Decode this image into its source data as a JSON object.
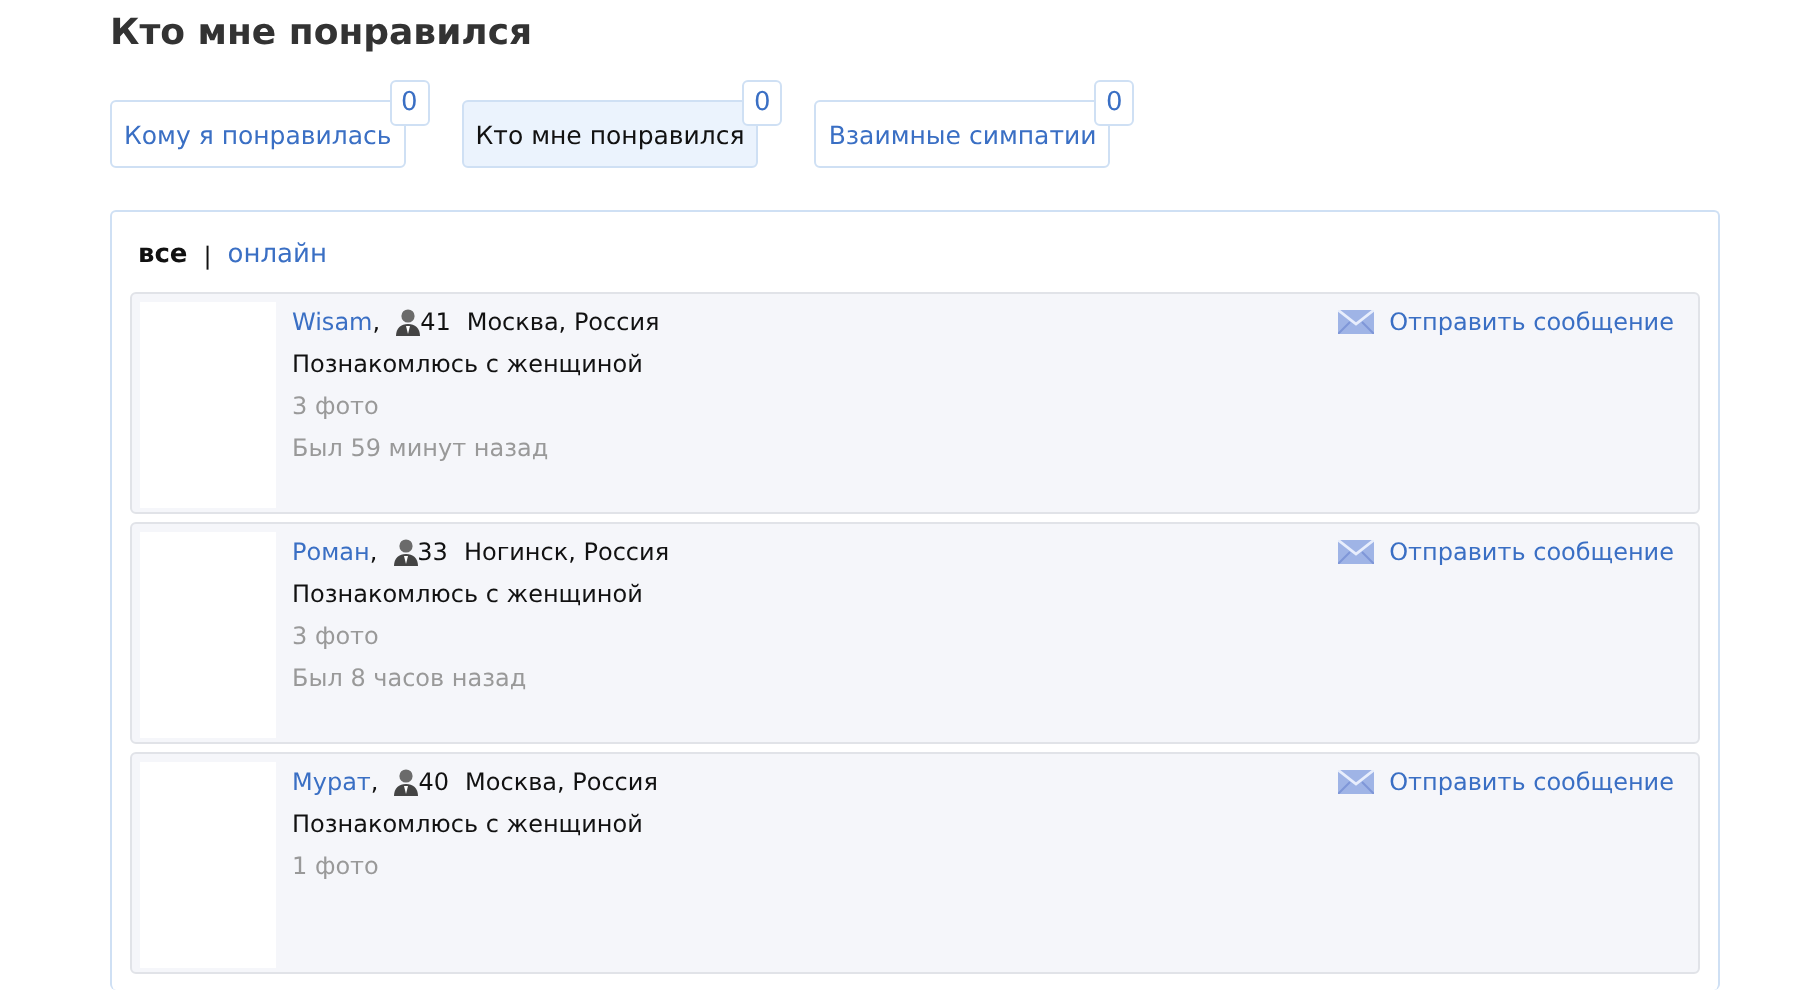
{
  "page_title": "Кто мне понравился",
  "tabs": [
    {
      "label": "Кому я понравилась",
      "count": "0",
      "selected": false
    },
    {
      "label": "Кто мне понравился",
      "count": "0",
      "selected": true
    },
    {
      "label": "Взаимные симпатии",
      "count": "0",
      "selected": false
    }
  ],
  "filters": [
    {
      "label": "все",
      "selected": true
    },
    {
      "label": "онлайн",
      "selected": false
    }
  ],
  "filter_separator": "|",
  "profiles": [
    {
      "name": "Wisam",
      "name_suffix": ",",
      "age": "41",
      "location": "Москва, Россия",
      "seeking": "Познакомлюсь с женщиной",
      "photos": "3 фото",
      "last_seen": "Был 59 минут назад",
      "action": "Отправить сообщение"
    },
    {
      "name": "Роман",
      "name_suffix": ",",
      "age": "33",
      "location": "Ногинск, Россия",
      "seeking": "Познакомлюсь с женщиной",
      "photos": "3 фото",
      "last_seen": "Был 8 часов назад",
      "action": "Отправить сообщение"
    },
    {
      "name": "Мурат",
      "name_suffix": ",",
      "age": "40",
      "location": "Москва, Россия",
      "seeking": "Познакомлюсь с женщиной",
      "photos": "1 фото",
      "action": "Отправить сообщение"
    }
  ]
}
